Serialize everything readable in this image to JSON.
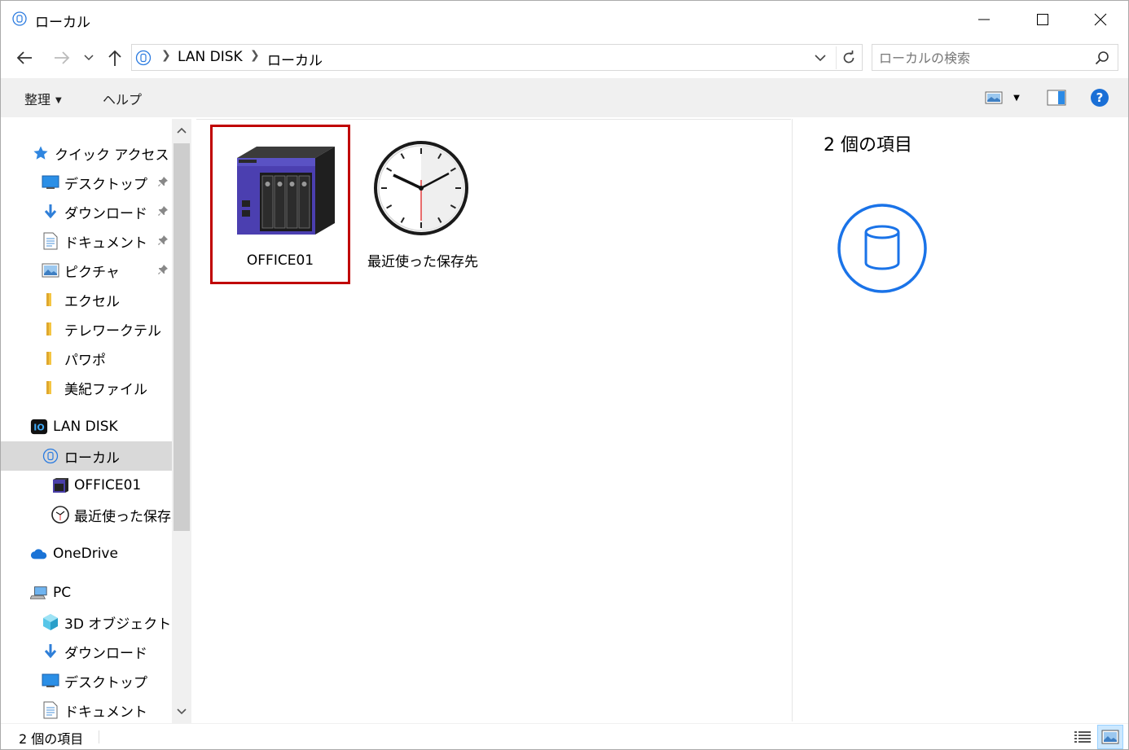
{
  "window": {
    "title": "ローカル",
    "icon": "network-drive-icon"
  },
  "address": {
    "crumbs": [
      "LAN DISK",
      "ローカル"
    ],
    "search_placeholder": "ローカルの検索"
  },
  "commands": {
    "organize_label": "整理",
    "help_label": "ヘルプ"
  },
  "nav": {
    "quick_access": "クイック アクセス",
    "quick_items": [
      {
        "label": "デスクトップ",
        "icon": "desktop-icon",
        "pinned": true
      },
      {
        "label": "ダウンロード",
        "icon": "download-icon",
        "pinned": true
      },
      {
        "label": "ドキュメント",
        "icon": "document-icon",
        "pinned": true
      },
      {
        "label": "ピクチャ",
        "icon": "picture-icon",
        "pinned": true
      },
      {
        "label": "エクセル",
        "icon": "folder-icon",
        "pinned": false
      },
      {
        "label": "テレワークテル",
        "icon": "folder-icon",
        "pinned": false
      },
      {
        "label": "パワポ",
        "icon": "folder-icon",
        "pinned": false
      },
      {
        "label": "美紀ファイル",
        "icon": "folder-icon",
        "pinned": false
      }
    ],
    "lan_disk": "LAN DISK",
    "local": "ローカル",
    "office01": "OFFICE01",
    "recent": "最近使った保存先",
    "onedrive": "OneDrive",
    "pc": "PC",
    "pc_items": [
      {
        "label": "3D オブジェクト",
        "icon": "3d-objects-icon"
      },
      {
        "label": "ダウンロード",
        "icon": "download-icon"
      },
      {
        "label": "デスクトップ",
        "icon": "desktop-icon"
      },
      {
        "label": "ドキュメント",
        "icon": "document-icon"
      }
    ]
  },
  "content": {
    "items": [
      {
        "label": "OFFICE01",
        "icon": "nas-device-icon",
        "selected": true
      },
      {
        "label": "最近使った保存先",
        "icon": "clock-icon",
        "selected": false
      }
    ]
  },
  "preview": {
    "title": "2 個の項目"
  },
  "status": {
    "text": "2 個の項目"
  },
  "colors": {
    "selection_border": "#c00000",
    "accent": "#1a73e8",
    "nav_selected": "#d9d9d9"
  }
}
